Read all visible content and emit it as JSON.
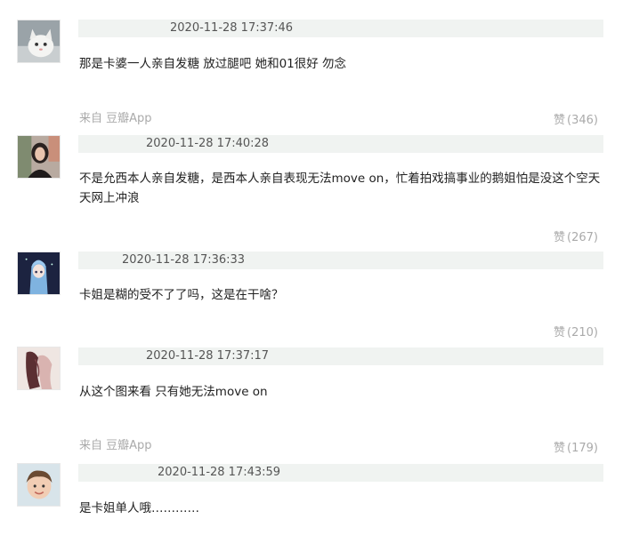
{
  "comments": [
    {
      "avatar_icon": "cat-avatar",
      "time": "2020-11-28 17:37:46",
      "text": "那是卡婆一人亲自发糖 放过腿吧 她和01很好 勿念",
      "source": "来自 豆瓣App",
      "like_label": "赞",
      "like_count": "(346)"
    },
    {
      "avatar_icon": "woman-avatar",
      "time": "2020-11-28 17:40:28",
      "text": "不是允西本人亲自发糖，是西本人亲自表现无法move on，忙着拍戏搞事业的鹅姐怕是没这个空天天网上冲浪",
      "like_label": "赞",
      "like_count": "(267)"
    },
    {
      "avatar_icon": "anime-girl-avatar",
      "time": "2020-11-28 17:36:33",
      "text": "卡姐是糊的受不了了吗，这是在干啥？",
      "like_label": "赞",
      "like_count": "(210)"
    },
    {
      "avatar_icon": "sketch-avatar",
      "time": "2020-11-28 17:37:17",
      "text": "从这个图来看 只有她无法move on",
      "source": "来自 豆瓣App",
      "like_label": "赞",
      "like_count": "(179)"
    },
    {
      "avatar_icon": "child-avatar",
      "time": "2020-11-28 17:43:59",
      "text": "是卡姐单人哦…………"
    }
  ]
}
